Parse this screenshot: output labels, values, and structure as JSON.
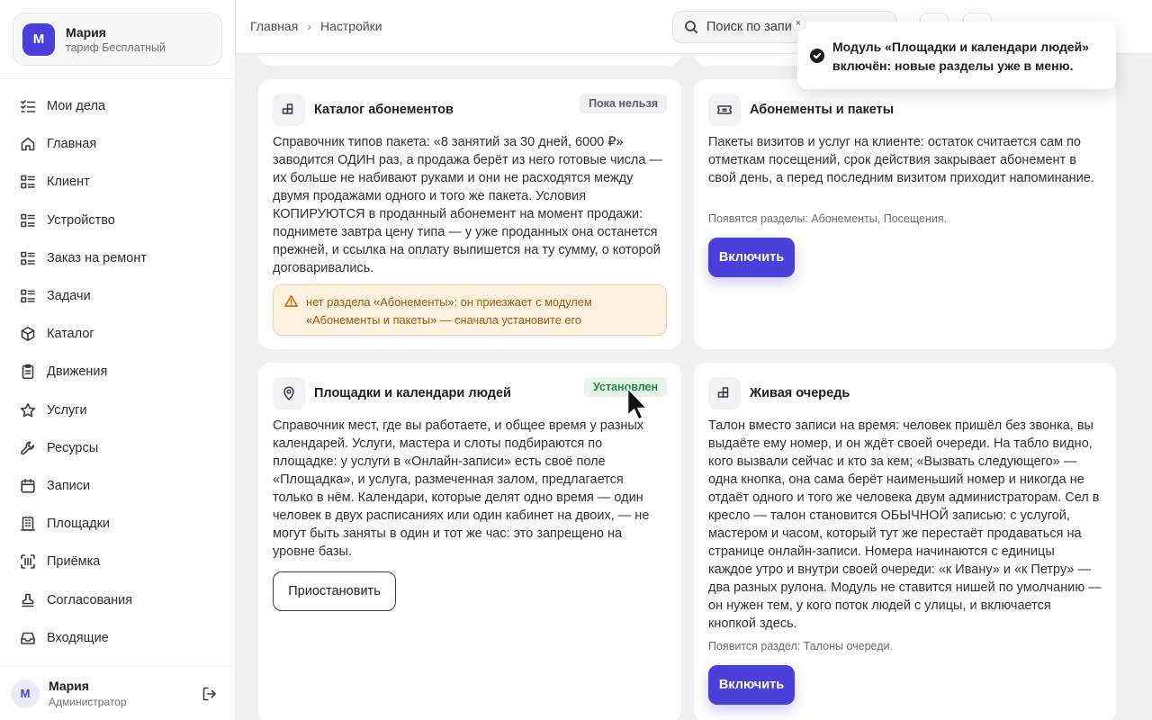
{
  "account": {
    "avatar": "М",
    "name": "Мария",
    "plan": "тариф Бесплатный"
  },
  "nav": [
    {
      "label": "Мои дела",
      "icon": "checklist-icon"
    },
    {
      "label": "Главная",
      "icon": "home-icon"
    },
    {
      "label": "Клиент",
      "icon": "list-icon"
    },
    {
      "label": "Устройство",
      "icon": "list-icon"
    },
    {
      "label": "Заказ на ремонт",
      "icon": "list-icon"
    },
    {
      "label": "Задачи",
      "icon": "list-icon"
    },
    {
      "label": "Каталог",
      "icon": "box-icon"
    },
    {
      "label": "Движения",
      "icon": "clipboard-icon"
    },
    {
      "label": "Услуги",
      "icon": "star-icon"
    },
    {
      "label": "Ресурсы",
      "icon": "wrench-icon"
    },
    {
      "label": "Записи",
      "icon": "calendar-icon"
    },
    {
      "label": "Площадки",
      "icon": "building-icon"
    },
    {
      "label": "Приёмка",
      "icon": "scan-icon"
    },
    {
      "label": "Согласования",
      "icon": "stamp-icon"
    },
    {
      "label": "Входящие",
      "icon": "inbox-icon"
    }
  ],
  "user": {
    "avatar": "М",
    "name": "Мария",
    "role": "Администратор"
  },
  "breadcrumb": {
    "home": "Главная",
    "sep": "›",
    "current": "Настройки"
  },
  "search": {
    "placeholder": "Поиск по запи"
  },
  "cards": {
    "catalog": {
      "title": "Каталог абонементов",
      "badge": "Пока нельзя",
      "desc": "Справочник типов пакета: «8 занятий за 30 дней, 6000 ₽» заводится ОДИН раз, а продажа берёт из него готовые числа — их больше не набивают руками и они не расходятся между двумя продажами одного и того же пакета. Условия КОПИРУЮТСЯ в проданный абонемент на момент продажи: поднимете завтра цену типа — у уже проданных она останется прежней, и ссылка на оплату выпишется на ту сумму, о которой договаривались.",
      "warning": "нет раздела «Абонементы»: он приезжает с модулем «Абонементы и пакеты» — сначала установите его"
    },
    "subscriptions": {
      "title": "Абонементы и пакеты",
      "desc": "Пакеты визитов и услуг на клиенте: остаток считается сам по отметкам посещений, срок действия закрывает абонемент в свой день, а перед последним визитом приходит напоминание.",
      "note": "Появятся разделы: Абонементы, Посещения.",
      "button": "Включить"
    },
    "venues": {
      "title": "Площадки и календари людей",
      "badge": "Установлен",
      "desc": "Справочник мест, где вы работаете, и общее время у разных календарей. Услуги, мастера и слоты подбираются по площадке: у услуги в «Онлайн-записи» есть своё поле «Площадка», и услуга, размеченная залом, предлагается только в нём. Календари, которые делят одно время — один человек в двух расписаниях или один кабинет на двоих, — не могут быть заняты в один и тот же час: это запрещено на уровне базы.",
      "button": "Приостановить"
    },
    "queue": {
      "title": "Живая очередь",
      "desc": "Талон вместо записи на время: человек пришёл без звонка, вы выдаёте ему номер, и он ждёт своей очереди. На табло видно, кого вызвали сейчас и кто за кем; «Вызвать следующего» — одна кнопка, она сама берёт наименьший номер и никогда не отдаёт одного и того же человека двум администраторам. Сел в кресло — талон становится ОБЫЧНОЙ записью: с услугой, мастером и часом, который тут же перестаёт продаваться на странице онлайн-записи. Номера начинаются с единицы каждое утро и внутри своей очереди: «к Ивану» и «к Петру» — два разных рулона. Модуль не ставится нишей по умолчанию — он нужен тем, у кого поток людей с улицы, и включается кнопкой здесь.",
      "note": "Появится раздел: Талоны очереди.",
      "button": "Включить"
    }
  },
  "toast": {
    "text": "Модуль «Площадки и календари людей» включён: новые разделы уже в меню.",
    "close": "×"
  },
  "colors": {
    "accent": "#4b3fd9",
    "installed": "#1f8a43",
    "warning": "#a35a0b"
  }
}
